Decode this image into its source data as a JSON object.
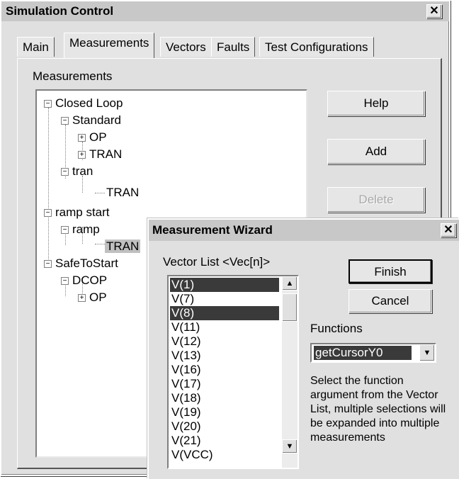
{
  "main_window": {
    "title": "Simulation Control",
    "close": "✕",
    "tabs": [
      "Main",
      "Measurements",
      "Vectors",
      "Faults",
      "Test Configurations"
    ],
    "active_tab": "Measurements",
    "section_label": "Measurements",
    "tree": [
      {
        "label": "Closed Loop",
        "expander": "−"
      },
      {
        "label": "Standard",
        "expander": "−"
      },
      {
        "label": "OP",
        "expander": "+"
      },
      {
        "label": "TRAN",
        "expander": "+"
      },
      {
        "label": "tran",
        "expander": "−"
      },
      {
        "label": "TRAN",
        "expander": ""
      },
      {
        "label": "ramp start",
        "expander": "−"
      },
      {
        "label": "ramp",
        "expander": "−"
      },
      {
        "label": "TRAN",
        "expander": ""
      },
      {
        "label": "SafeToStart",
        "expander": "−"
      },
      {
        "label": "DCOP",
        "expander": "−"
      },
      {
        "label": "OP",
        "expander": "+"
      }
    ],
    "buttons": {
      "help": "Help",
      "add": "Add",
      "delete": "Delete"
    }
  },
  "wizard": {
    "title": "Measurement Wizard",
    "close": "✕",
    "vector_list_label": "Vector List  <Vec[n]>",
    "vectors": [
      "V(1)",
      "V(7)",
      "V(8)",
      "V(11)",
      "V(12)",
      "V(13)",
      "V(16)",
      "V(17)",
      "V(18)",
      "V(19)",
      "V(20)",
      "V(21)",
      "V(VCC)"
    ],
    "selected_vectors": [
      "V(1)",
      "V(8)"
    ],
    "finish": "Finish",
    "cancel": "Cancel",
    "functions_label": "Functions",
    "function_value": "getCursorY0",
    "help_text": "Select the function argument from the Vector List, multiple selections will be expanded into multiple measurements",
    "scroll_up": "▲",
    "scroll_down": "▼",
    "dropdown": "▼"
  }
}
